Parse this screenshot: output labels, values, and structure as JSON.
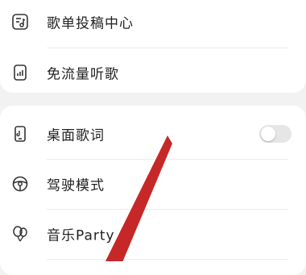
{
  "top_section": {
    "items": [
      {
        "label": "歌单投稿中心",
        "icon": "playlist-submit-icon"
      },
      {
        "label": "免流量听歌",
        "icon": "data-free-icon"
      }
    ]
  },
  "bottom_section": {
    "items": [
      {
        "label": "桌面歌词",
        "icon": "desktop-lyrics-icon",
        "toggle": "off"
      },
      {
        "label": "驾驶模式",
        "icon": "steering-wheel-icon"
      },
      {
        "label": "音乐Party",
        "icon": "balloon-icon"
      }
    ]
  },
  "colors": {
    "background": "#f2f2f2",
    "card": "#ffffff",
    "annotation_arrow": "#c62828",
    "toggle_off": "#e6e6e6"
  }
}
